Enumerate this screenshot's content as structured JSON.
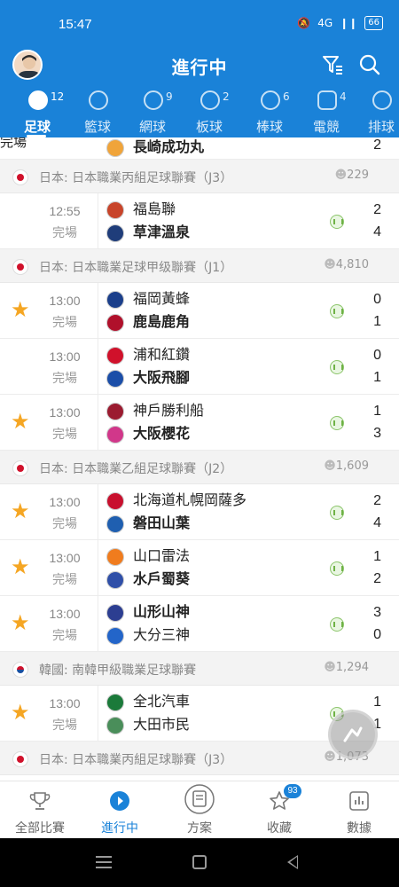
{
  "status_bar": {
    "time": "15:47",
    "signal": "4G",
    "battery": "66"
  },
  "header": {
    "title": "進行中"
  },
  "sports_tabs": [
    {
      "label": "足球",
      "count": "12",
      "active": true
    },
    {
      "label": "籃球",
      "count": ""
    },
    {
      "label": "網球",
      "count": "9"
    },
    {
      "label": "板球",
      "count": "2"
    },
    {
      "label": "棒球",
      "count": "6"
    },
    {
      "label": "電競",
      "count": "4"
    },
    {
      "label": "排球",
      "count": ""
    }
  ],
  "partial_match": {
    "status": "完場",
    "away_team": "長崎成功丸",
    "away_score": "2"
  },
  "leagues": [
    {
      "flag": "jp",
      "name": "日本: 日本職業丙組足球聯賽（J3）",
      "watchers": "229",
      "matches": [
        {
          "star": false,
          "time": "12:55",
          "status": "完場",
          "home": "福島聯",
          "away": "草津溫泉",
          "home_score": "2",
          "away_score": "4",
          "home_crest": "#c8442a",
          "away_crest": "#1f3d7a",
          "bold": "away"
        }
      ]
    },
    {
      "flag": "jp",
      "name": "日本: 日本職業足球甲级聯賽（J1）",
      "watchers": "4,810",
      "matches": [
        {
          "star": true,
          "time": "13:00",
          "status": "完場",
          "home": "福岡黃蜂",
          "away": "鹿島鹿角",
          "home_score": "0",
          "away_score": "1",
          "home_crest": "#1b3f8b",
          "away_crest": "#b0102b",
          "bold": "away"
        },
        {
          "star": false,
          "time": "13:00",
          "status": "完場",
          "home": "浦和紅鑽",
          "away": "大阪飛腳",
          "home_score": "0",
          "away_score": "1",
          "home_crest": "#d0112b",
          "away_crest": "#1b4ea8",
          "bold": "away"
        },
        {
          "star": true,
          "time": "13:00",
          "status": "完場",
          "home": "神戶勝利船",
          "away": "大阪櫻花",
          "home_score": "1",
          "away_score": "3",
          "home_crest": "#9b1b30",
          "away_crest": "#d1378a",
          "bold": "away"
        }
      ]
    },
    {
      "flag": "jp",
      "name": "日本: 日本職業乙組足球聯賽（J2）",
      "watchers": "1,609",
      "matches": [
        {
          "star": true,
          "time": "13:00",
          "status": "完場",
          "home": "北海道札幌岡薩多",
          "away": "磐田山葉",
          "home_score": "2",
          "away_score": "4",
          "home_crest": "#c8102e",
          "away_crest": "#1f5fb0",
          "bold": "away"
        },
        {
          "star": true,
          "time": "13:00",
          "status": "完場",
          "home": "山口雷法",
          "away": "水戶蜀葵",
          "home_score": "1",
          "away_score": "2",
          "home_crest": "#f07c1e",
          "away_crest": "#2f4fa8",
          "bold": "away"
        },
        {
          "star": true,
          "time": "13:00",
          "status": "完場",
          "home": "山形山神",
          "away": "大分三神",
          "home_score": "3",
          "away_score": "0",
          "home_crest": "#2c3e91",
          "away_crest": "#2365c9",
          "bold": "home"
        }
      ]
    },
    {
      "flag": "kr",
      "name": "韓國: 南韓甲級職業足球聯賽",
      "watchers": "1,294",
      "matches": [
        {
          "star": true,
          "time": "13:00",
          "status": "完場",
          "home": "全北汽車",
          "away": "大田市民",
          "home_score": "1",
          "away_score": "1",
          "home_crest": "#1b7a3a",
          "away_crest": "#4a8e5a",
          "bold": "none"
        }
      ]
    },
    {
      "flag": "jp",
      "name": "日本: 日本職業丙組足球聯賽（J3）",
      "watchers": "1,073",
      "matches": []
    }
  ],
  "bottom_nav": [
    {
      "label": "全部比賽",
      "icon": "trophy-icon",
      "active": false
    },
    {
      "label": "進行中",
      "icon": "play-icon",
      "active": true
    },
    {
      "label": "方案",
      "icon": "document-icon",
      "active": false
    },
    {
      "label": "收藏",
      "icon": "star-icon",
      "active": false,
      "badge": "93"
    },
    {
      "label": "數據",
      "icon": "chart-icon",
      "active": false
    }
  ],
  "colors": {
    "brand": "#1a82d8",
    "star": "#f5a623",
    "stat": "#6fb246"
  }
}
